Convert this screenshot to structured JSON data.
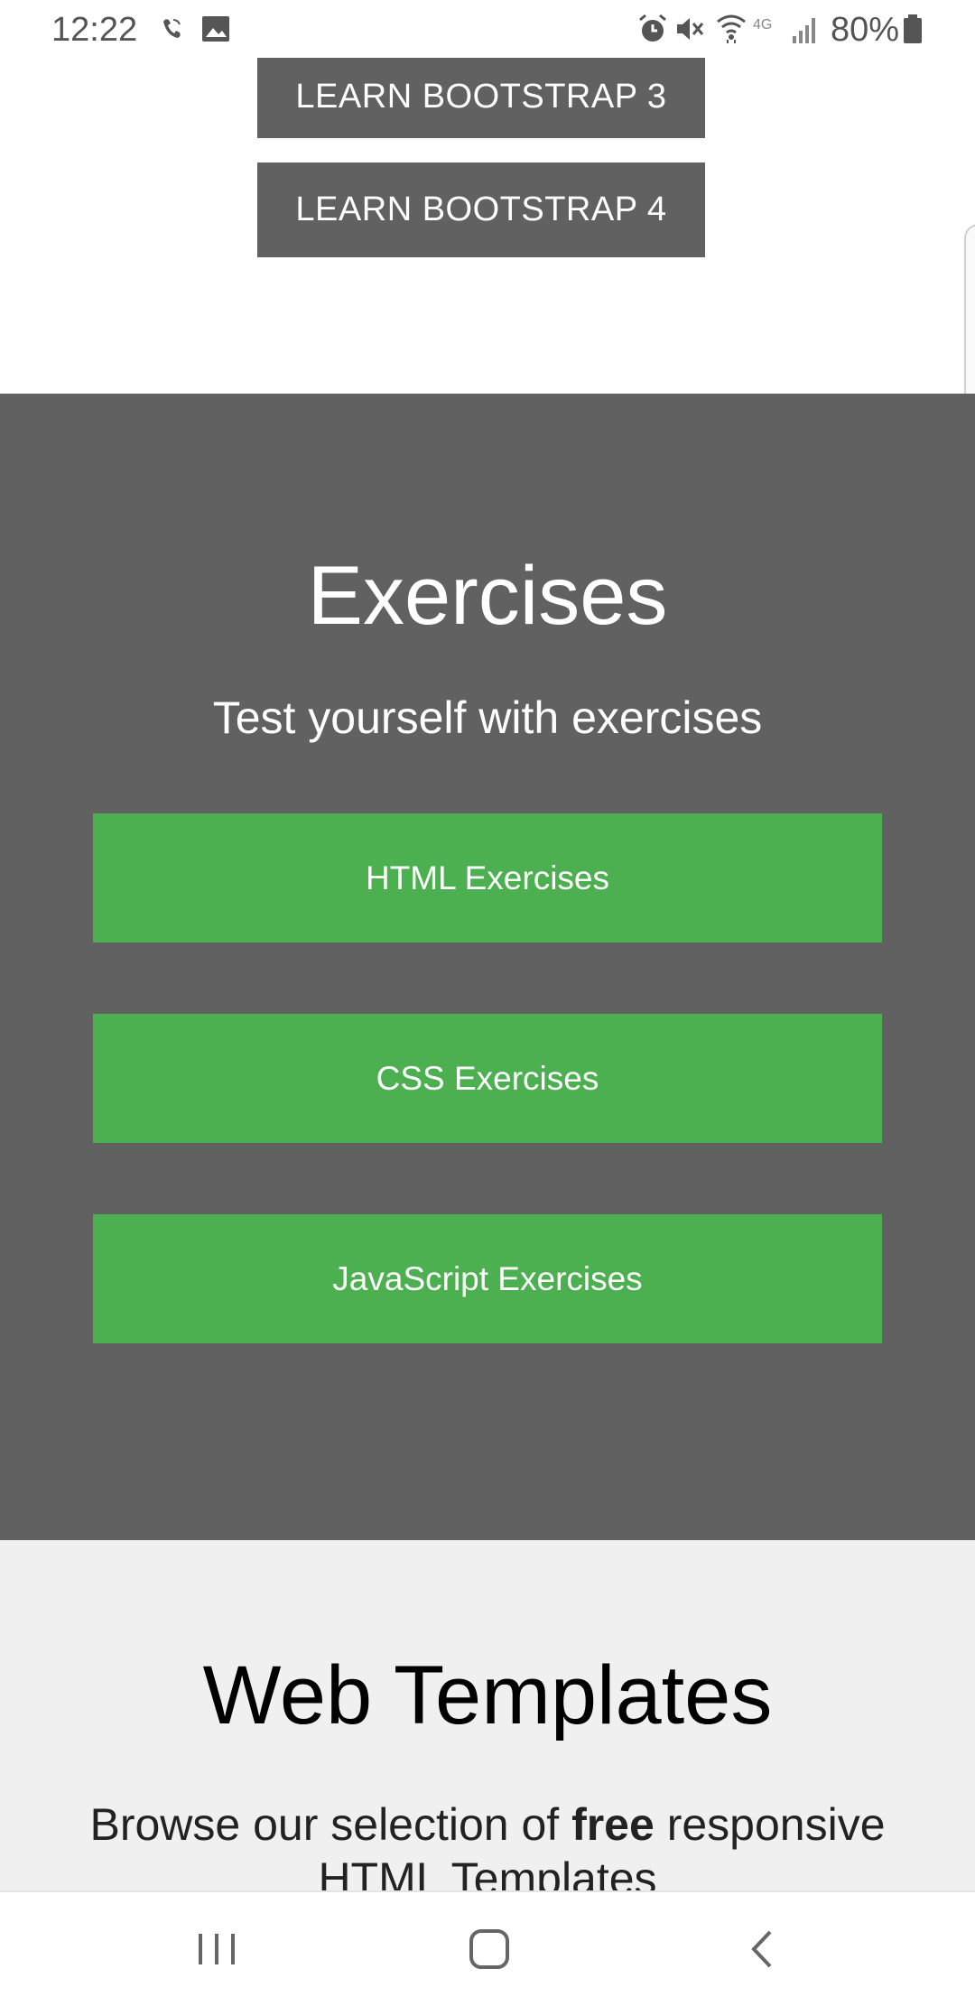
{
  "status_bar": {
    "time": "12:22",
    "network": "4G",
    "battery": "80%",
    "icons": [
      "wifi-call-icon",
      "gallery-icon",
      "alarm-icon",
      "mute-icon",
      "wifi-icon",
      "lte-icon",
      "signal-icon",
      "battery-icon"
    ]
  },
  "top": {
    "bootstrap3": "LEARN BOOTSTRAP 3",
    "bootstrap4": "LEARN BOOTSTRAP 4"
  },
  "exercises": {
    "title": "Exercises",
    "subtitle": "Test yourself with exercises",
    "buttons": [
      "HTML Exercises",
      "CSS Exercises",
      "JavaScript Exercises"
    ]
  },
  "templates": {
    "title": "Web Templates",
    "desc_before": "Browse our selection of ",
    "desc_bold": "free",
    "desc_after": " responsive HTML Templates"
  },
  "nav_bar": {
    "icons": [
      "recent-apps-icon",
      "home-icon",
      "back-icon"
    ]
  },
  "colors": {
    "dark_gray": "#616161",
    "green": "#4caf50",
    "light_gray": "#f0f0f0"
  }
}
